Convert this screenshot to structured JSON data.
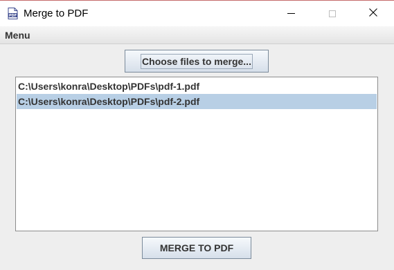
{
  "window": {
    "title": "Merge to PDF",
    "icon": "pdf-icon",
    "controls": [
      "minimize-icon",
      "maximize-icon",
      "close-icon"
    ]
  },
  "menubar": {
    "items": [
      {
        "label": "Menu"
      }
    ]
  },
  "toolbar": {
    "choose_label": "Choose files to merge..."
  },
  "file_list": {
    "items": [
      {
        "path": "C:\\Users\\konra\\Desktop\\PDFs\\pdf-1.pdf",
        "selected": false
      },
      {
        "path": "C:\\Users\\konra\\Desktop\\PDFs\\pdf-2.pdf",
        "selected": true
      }
    ]
  },
  "actions": {
    "merge_label": "MERGE TO PDF"
  },
  "colors": {
    "selection": "#b8cfe5",
    "button_border": "#7a8a9a",
    "background": "#eeeeee"
  }
}
